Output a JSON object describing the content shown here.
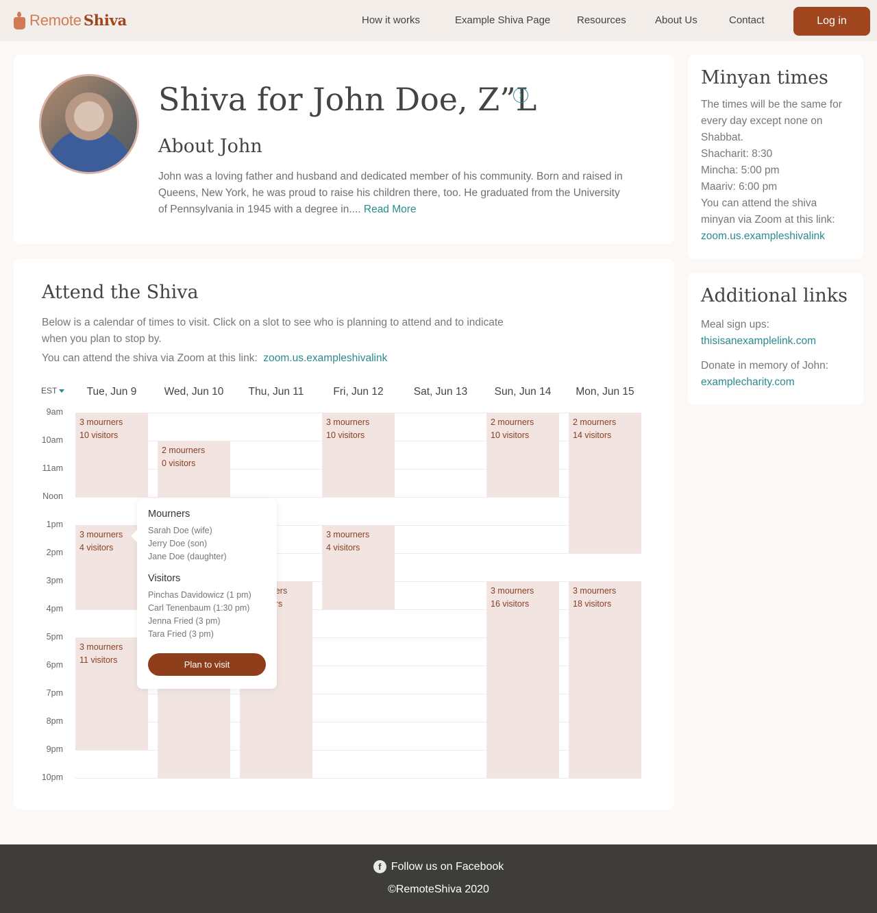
{
  "brand": {
    "name_light": "Remote",
    "name_bold": "Shiva"
  },
  "nav": {
    "items": [
      "How it works",
      "Example Shiva Page",
      "Resources",
      "About Us",
      "Contact"
    ],
    "login_label": "Log in"
  },
  "hero": {
    "title": "Shiva for John Doe, Z”L",
    "info_glyph": "i",
    "about_title": "About John",
    "about_text": "John was a loving father and husband and dedicated member of his community. Born and raised in Queens, New York, he was proud to raise his children there, too. He graduated from the University of Pennsylvania in 1945 with a degree in....",
    "read_more": "Read More"
  },
  "minyan": {
    "title": "Minyan times",
    "lines": [
      "The times will be the same for every day except none on Shabbat.",
      "Shacharit: 8:30",
      "Mincha: 5:00 pm",
      "Maariv: 6:00 pm",
      "You can attend the shiva minyan via Zoom at this link:"
    ],
    "link": "zoom.us.exampleshivalink"
  },
  "additional": {
    "title": "Additional links",
    "meal_label": "Meal sign ups:",
    "meal_link": "thisisanexamplelink.com",
    "donate_label": "Donate in memory of John:",
    "donate_link": "examplecharity.com"
  },
  "attend": {
    "title": "Attend the Shiva",
    "description": "Below is a calendar of times to visit. Click on a slot to see who is planning to attend and to indicate when you plan to stop by.",
    "zoom_label": "You can attend the shiva via Zoom at this link:",
    "zoom_link": "zoom.us.exampleshivalink"
  },
  "calendar": {
    "timezone": "EST",
    "days": [
      "Tue, Jun 9",
      "Wed, Jun 10",
      "Thu, Jun 11",
      "Fri, Jun 12",
      "Sat, Jun 13",
      "Sun, Jun 14",
      "Mon, Jun 15"
    ],
    "times": [
      "9am",
      "10am",
      "11am",
      "Noon",
      "1pm",
      "2pm",
      "3pm",
      "4pm",
      "5pm",
      "6pm",
      "7pm",
      "8pm",
      "9pm",
      "10pm"
    ],
    "slots": [
      {
        "day": 0,
        "start": 9,
        "end": 12,
        "mourners": "3 mourners",
        "visitors": "10 visitors"
      },
      {
        "day": 0,
        "start": 13,
        "end": 16,
        "mourners": "3 mourners",
        "visitors": "4 visitors"
      },
      {
        "day": 0,
        "start": 17,
        "end": 21,
        "mourners": "3 mourners",
        "visitors": "11 visitors"
      },
      {
        "day": 1,
        "start": 10,
        "end": 12,
        "mourners": "2 mourners",
        "visitors": "0 visitors"
      },
      {
        "day": 1,
        "start": 13,
        "end": 16,
        "mourners": "",
        "visitors": ""
      },
      {
        "day": 1,
        "start": 17,
        "end": 22,
        "mourners": "",
        "visitors": ""
      },
      {
        "day": 2,
        "start": 15,
        "end": 22,
        "mourners": "3 mourners",
        "visitors": "15 visitors"
      },
      {
        "day": 3,
        "start": 9,
        "end": 12,
        "mourners": "3 mourners",
        "visitors": "10 visitors"
      },
      {
        "day": 3,
        "start": 13,
        "end": 16,
        "mourners": "3 mourners",
        "visitors": "4 visitors"
      },
      {
        "day": 5,
        "start": 9,
        "end": 12,
        "mourners": "2 mourners",
        "visitors": "10 visitors"
      },
      {
        "day": 5,
        "start": 15,
        "end": 22,
        "mourners": "3 mourners",
        "visitors": "16 visitors"
      },
      {
        "day": 6,
        "start": 9,
        "end": 14,
        "mourners": "2 mourners",
        "visitors": "14 visitors"
      },
      {
        "day": 6,
        "start": 15,
        "end": 22,
        "mourners": "3 mourners",
        "visitors": "18 visitors"
      }
    ]
  },
  "popover": {
    "mourners_title": "Mourners",
    "mourners": [
      "Sarah Doe (wife)",
      "Jerry Doe (son)",
      "Jane Doe (daughter)"
    ],
    "visitors_title": "Visitors",
    "visitors": [
      "Pinchas Davidowicz (1 pm)",
      "Carl Tenenbaum (1:30 pm)",
      "Jenna Fried (3 pm)",
      "Tara Fried (3 pm)"
    ],
    "button_label": "Plan to visit"
  },
  "footer": {
    "facebook_glyph": "f",
    "facebook_label": "Follow us on Facebook",
    "copyright": "©RemoteShiva 2020"
  },
  "colors": {
    "accent": "#a0461f",
    "link": "#2a8a8f",
    "slot": "#f2e5e1",
    "header_bg": "#f3eee9",
    "footer_bg": "#3e3d39"
  }
}
